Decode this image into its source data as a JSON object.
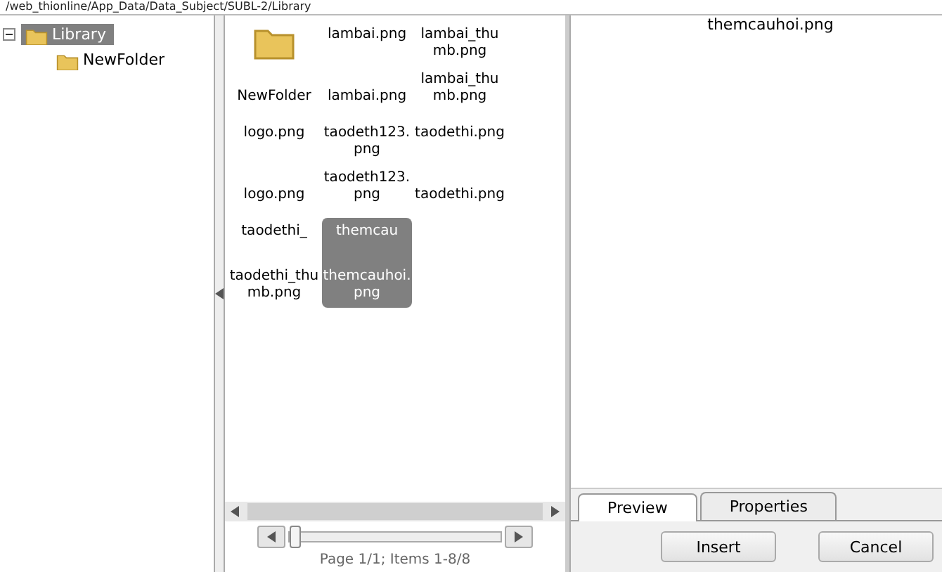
{
  "path": "/web_thionline/App_Data/Data_Subject/SUBL-2/Library",
  "tree": [
    {
      "label": "Library",
      "selected": true,
      "expanded": true,
      "children": [
        {
          "label": "NewFolder",
          "selected": false
        }
      ]
    }
  ],
  "files": [
    {
      "kind": "folder",
      "caption": "NewFolder",
      "selected": false
    },
    {
      "kind": "image",
      "alt": "lambai.png",
      "caption": "lambai.png",
      "selected": false
    },
    {
      "kind": "image",
      "alt": "lambai_thumb.png",
      "caption": "lambai_thumb.png",
      "selected": false
    },
    {
      "kind": "image",
      "alt": "logo.png",
      "caption": "logo.png",
      "selected": false
    },
    {
      "kind": "image",
      "alt": "taodeth123.png",
      "caption": "taodeth123.png",
      "selected": false
    },
    {
      "kind": "image",
      "alt": "taodethi.png",
      "caption": "taodethi.png",
      "selected": false
    },
    {
      "kind": "image",
      "alt": "taodethi_",
      "caption": "taodethi_thumb.png",
      "selected": false
    },
    {
      "kind": "image",
      "alt": "themcau",
      "caption": "themcauhoi.png",
      "selected": true
    }
  ],
  "pager": {
    "level": 0.0,
    "status": "Page 1/1; Items 1-8/8"
  },
  "preview": {
    "alt": "themcauhoi.png"
  },
  "tabs": [
    {
      "label": "Preview",
      "selected": true
    },
    {
      "label": "Properties",
      "selected": false
    }
  ],
  "buttons": [
    "Insert",
    "Cancel"
  ]
}
